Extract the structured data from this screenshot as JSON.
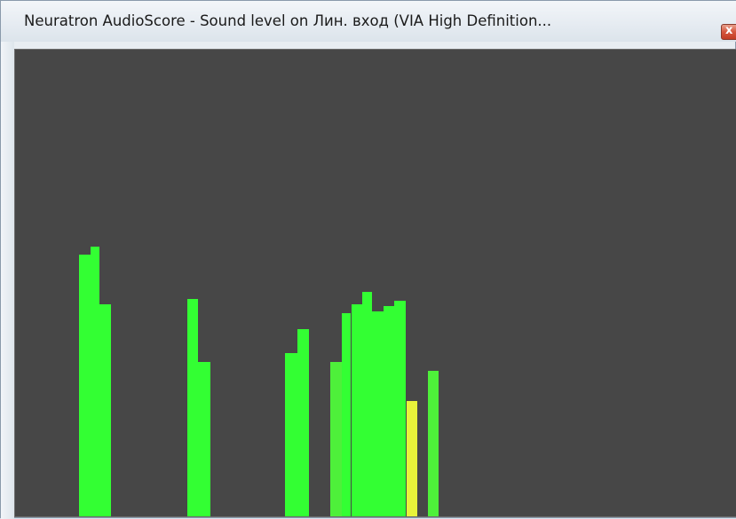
{
  "window": {
    "title": "Neuratron AudioScore - Sound level on Лин. вход (VIA High Definition...",
    "close_label": "x"
  },
  "meter": {
    "background": "#474747",
    "colors": {
      "green": "#33ff33",
      "light_green": "#4ef03a",
      "yellow": "#e8f33a"
    },
    "columns": [
      {
        "level": 0.56,
        "color": "green"
      },
      {
        "level": 0.578,
        "color": "green"
      },
      {
        "level": 0.455,
        "color": "green"
      },
      {
        "level": 0.466,
        "color": "green"
      },
      {
        "level": 0.33,
        "color": "green"
      },
      {
        "level": 0.349,
        "color": "green"
      },
      {
        "level": 0.402,
        "color": "green"
      },
      {
        "level": 0.33,
        "color": "light_green"
      },
      {
        "level": 0.436,
        "color": "green"
      },
      {
        "level": 0.455,
        "color": "green"
      },
      {
        "level": 0.481,
        "color": "green"
      },
      {
        "level": 0.439,
        "color": "green"
      },
      {
        "level": 0.451,
        "color": "green"
      },
      {
        "level": 0.462,
        "color": "green"
      },
      {
        "level": 0.248,
        "color": "yellow"
      },
      {
        "level": 0.311,
        "color": "light_green"
      }
    ]
  }
}
